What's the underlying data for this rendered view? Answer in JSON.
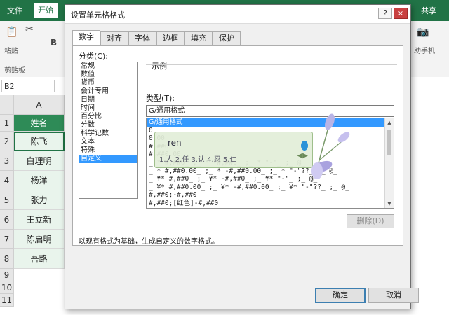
{
  "excel": {
    "ribbon_tabs": [
      "文件",
      "开始"
    ],
    "ribbon_right_text": "共享",
    "clipboard_label": "剪贴板",
    "paste_label": "粘贴",
    "right_label": "助手机",
    "namebox": "B2",
    "column_header": "A",
    "rows": [
      "1",
      "2",
      "3",
      "4",
      "5",
      "6",
      "7",
      "8",
      "9",
      "10",
      "11"
    ],
    "cells": [
      "姓名",
      "陈飞",
      "白理明",
      "杨洋",
      "张力",
      "王立新",
      "陈启明",
      "吾路"
    ]
  },
  "dialog": {
    "title": "设置单元格格式",
    "tabs": [
      "数字",
      "对齐",
      "字体",
      "边框",
      "填充",
      "保护"
    ],
    "category_label": "分类(C):",
    "categories": [
      "常规",
      "数值",
      "货币",
      "会计专用",
      "日期",
      "时间",
      "百分比",
      "分数",
      "科学记数",
      "文本",
      "特殊",
      "自定义"
    ],
    "selected_category": "自定义",
    "sample_label": "示例",
    "type_label": "类型(T):",
    "type_value": "G/通用格式",
    "formats": [
      "G/通用格式",
      "0",
      "0.00",
      "#,##0",
      "#,##0.00",
      "_ * #,##0_ ;_ * -#,##0_ ;_ * \"-\"_ ;_ @_",
      "_ * #,##0.00_ ;_ * -#,##0.00_ ;_ * \"-\"??_ ;_ @_",
      "_ ¥* #,##0_ ;_ ¥* -#,##0_ ;_ ¥* \"-\"_ ;_ @_",
      "_ ¥* #,##0.00_ ;_ ¥* -#,##0.00_ ;_ ¥* \"-\"??_ ;_ @_",
      "#,##0;-#,##0",
      "#,##0;[红色]-#,##0"
    ],
    "delete_label": "删除(D)",
    "description": "以现有格式为基础，生成自定义的数字格式。",
    "ok_label": "确定",
    "cancel_label": "取消",
    "help_label": "?",
    "close_label": "×",
    "ime": {
      "composition": "ren",
      "candidates": "1.人  2.任  3.认  4.忍  5.仁",
      "page_arrows": "◀▶"
    }
  },
  "colors": {
    "excel_green": "#217346",
    "selection_blue": "#3399ff",
    "header_fill": "#2e8b57"
  }
}
